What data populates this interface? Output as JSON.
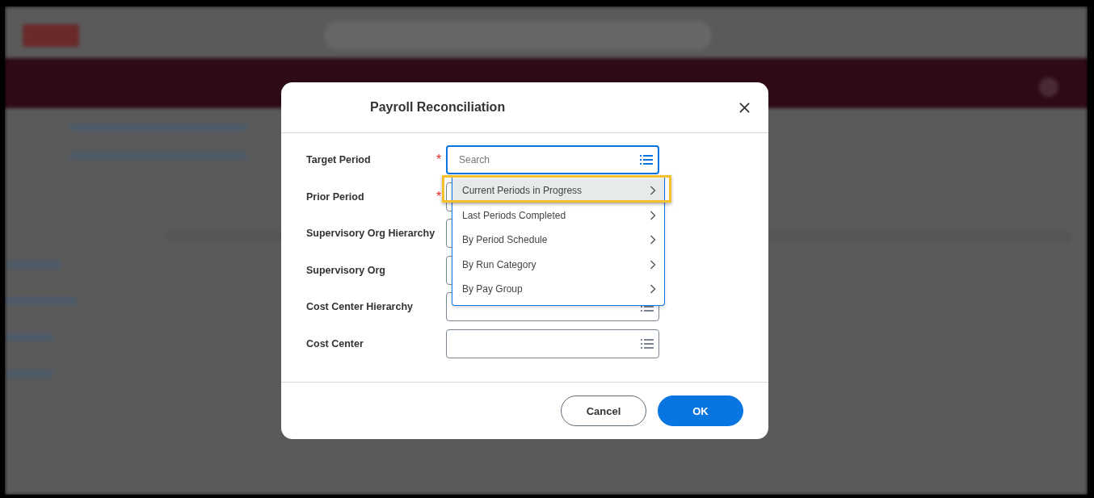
{
  "dialog": {
    "title": "Payroll Reconciliation",
    "fields": [
      {
        "label": "Target Period",
        "required_mark": "*",
        "focused": true,
        "placeholder": "Search"
      },
      {
        "label": "Prior Period",
        "required_mark": "*",
        "focused": false
      },
      {
        "label": "Supervisory Org Hierarchy",
        "focused": false
      },
      {
        "label": "Supervisory Org",
        "focused": false
      },
      {
        "label": "Cost Center Hierarchy",
        "focused": false
      },
      {
        "label": "Cost Center",
        "focused": false
      }
    ],
    "dropdown": {
      "items": [
        {
          "label": "Current Periods in Progress",
          "selected": true,
          "annotated": true
        },
        {
          "label": "Last Periods Completed",
          "selected": false,
          "annotated": false
        },
        {
          "label": "By Period Schedule",
          "selected": false,
          "annotated": false
        },
        {
          "label": "By Run Category",
          "selected": false,
          "annotated": false
        },
        {
          "label": "By Pay Group",
          "selected": false,
          "annotated": false
        }
      ]
    },
    "buttons": [
      {
        "label": "Cancel",
        "kind": "secondary"
      },
      {
        "label": "OK",
        "kind": "primary"
      }
    ]
  }
}
